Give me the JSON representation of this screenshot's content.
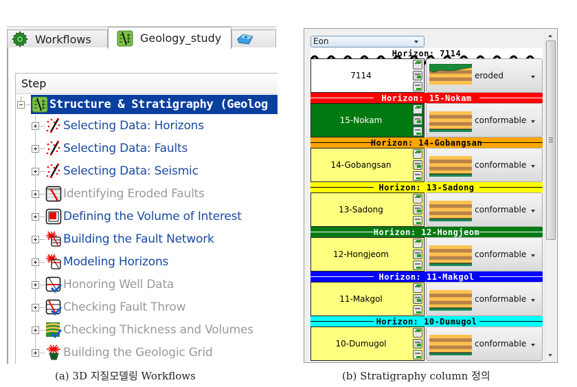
{
  "left_panel": {
    "tabs": [
      {
        "label": "Workflows",
        "icon": "gear-icon",
        "active": false
      },
      {
        "label": "Geology_study",
        "icon": "geology-study-icon",
        "active": true
      },
      {
        "label": "",
        "icon": "3d-block-icon",
        "active": false
      }
    ],
    "tree": {
      "header": "Step",
      "root": {
        "label": "Structure & Stratigraphy (Geolog",
        "icon": "geology-study-icon",
        "selected": true,
        "expanded": true
      },
      "items": [
        {
          "label": "Selecting Data: Horizons",
          "icon": "select-data-icon",
          "enabled": true
        },
        {
          "label": "Selecting Data: Faults",
          "icon": "select-data-icon",
          "enabled": true
        },
        {
          "label": "Selecting Data: Seismic",
          "icon": "select-data-icon",
          "enabled": true
        },
        {
          "label": "Identifying Eroded Faults",
          "icon": "eroded-fault-icon",
          "enabled": false
        },
        {
          "label": "Defining the Volume of Interest",
          "icon": "volume-of-interest-icon",
          "enabled": true
        },
        {
          "label": "Building the Fault Network",
          "icon": "fault-network-icon",
          "enabled": true
        },
        {
          "label": "Modeling Horizons",
          "icon": "modeling-horizons-icon",
          "enabled": true
        },
        {
          "label": "Honoring Well Data",
          "icon": "well-data-check-icon",
          "enabled": false
        },
        {
          "label": "Checking Fault Throw",
          "icon": "fault-throw-check-icon",
          "enabled": false
        },
        {
          "label": "Checking Thickness and Volumes",
          "icon": "thickness-check-icon",
          "enabled": false
        },
        {
          "label": "Building the Geologic Grid",
          "icon": "geologic-grid-icon",
          "enabled": false
        }
      ]
    },
    "caption": "(a) 3D 지질모델링 Workflows"
  },
  "right_panel": {
    "combo": {
      "value": "Eon"
    },
    "column": [
      {
        "horizon": "Horizon: 7114",
        "horizon_color": "#ffffff",
        "horizon_text_color": "#000000",
        "wavy": true,
        "unit": "7114",
        "unit_color": "#ffffff",
        "unit_text_color": "#000000",
        "contact": "eroded"
      },
      {
        "horizon": "Horizon: 15-Nokam",
        "horizon_color": "#ff0000",
        "horizon_text_color": "#ffffff",
        "wavy": false,
        "unit": "15-Nokam",
        "unit_color": "#007a10",
        "unit_text_color": "#ffffff",
        "contact": "conformable"
      },
      {
        "horizon": "Horizon: 14-Gobangsan",
        "horizon_color": "#ffa500",
        "horizon_text_color": "#000000",
        "wavy": false,
        "unit": "14-Gobangsan",
        "unit_color": "#ffff80",
        "unit_text_color": "#000000",
        "contact": "conformable"
      },
      {
        "horizon": "Horizon: 13-Sadong",
        "horizon_color": "#ffff00",
        "horizon_text_color": "#000000",
        "wavy": false,
        "unit": "13-Sadong",
        "unit_color": "#ffff80",
        "unit_text_color": "#000000",
        "contact": "conformable"
      },
      {
        "horizon": "Horizon: 12-Hongjeom",
        "horizon_color": "#007a10",
        "horizon_text_color": "#ffffff",
        "wavy": false,
        "unit": "12-Hongjeom",
        "unit_color": "#ffff80",
        "unit_text_color": "#000000",
        "contact": "conformable"
      },
      {
        "horizon": "Horizon: 11-Makgol",
        "horizon_color": "#0000ff",
        "horizon_text_color": "#ffffff",
        "wavy": false,
        "unit": "11-Makgol",
        "unit_color": "#ffff80",
        "unit_text_color": "#000000",
        "contact": "conformable"
      },
      {
        "horizon": "Horizon: 10-Dumugol",
        "horizon_color": "#00ffff",
        "horizon_text_color": "#000000",
        "wavy": false,
        "unit": "10-Dumugol",
        "unit_color": "#ffff80",
        "unit_text_color": "#000000",
        "contact": "conformable"
      }
    ],
    "caption": "(b) Stratigraphy column 정의"
  }
}
